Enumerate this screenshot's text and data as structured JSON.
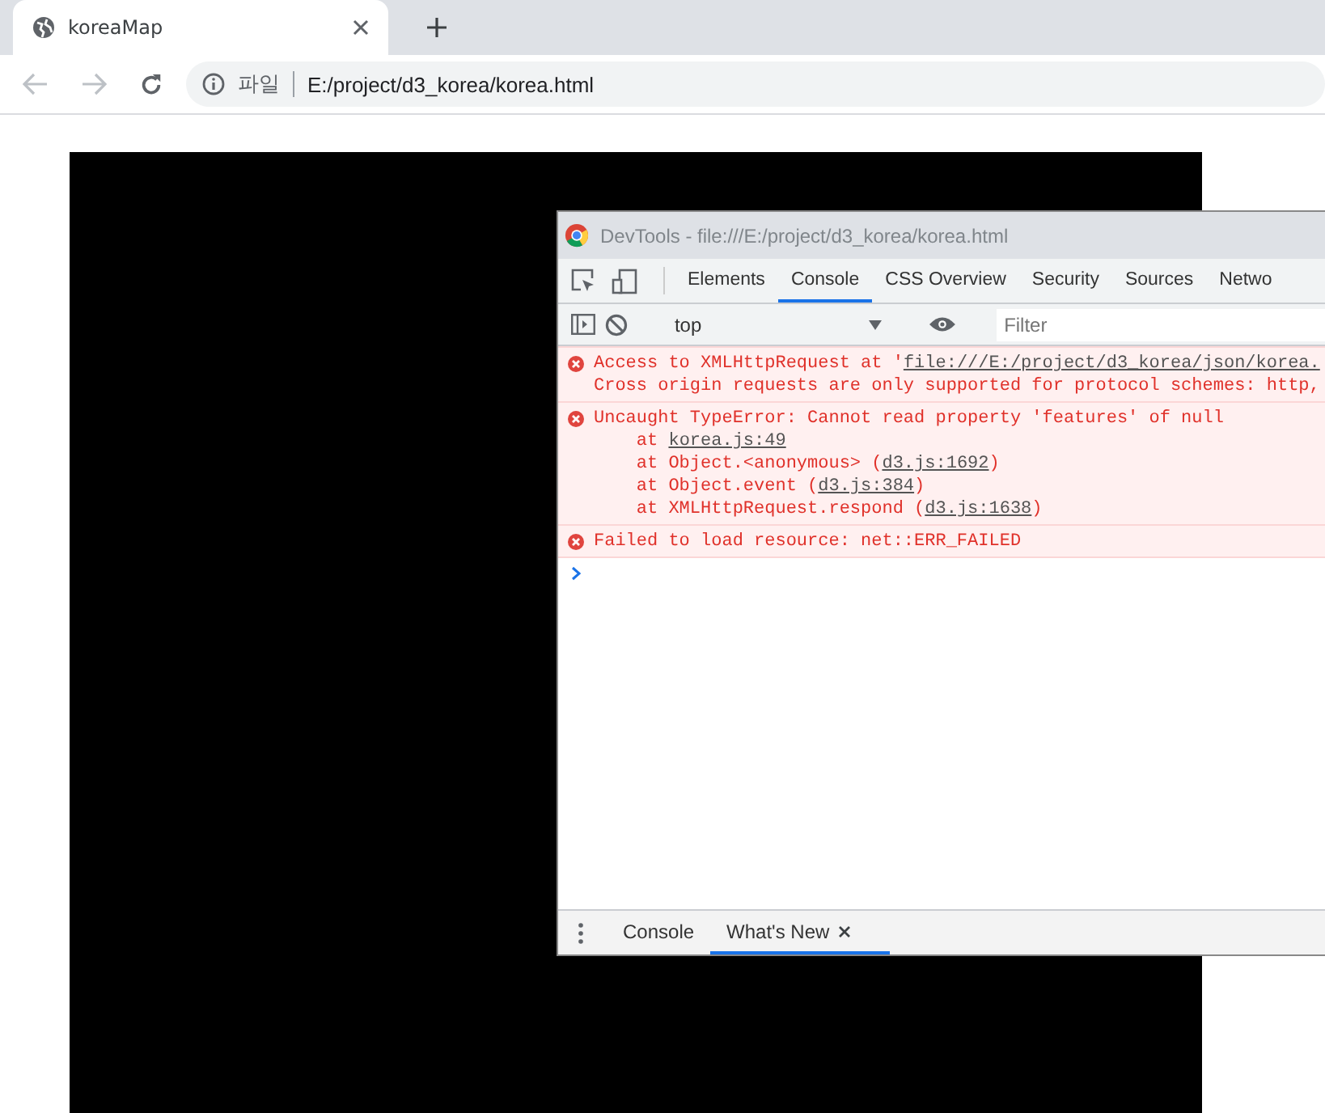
{
  "browser": {
    "tab": {
      "title": "koreaMap"
    },
    "address": {
      "scheme_label": "파일",
      "url": "E:/project/d3_korea/korea.html"
    }
  },
  "devtools": {
    "title": "DevTools - file:///E:/project/d3_korea/korea.html",
    "tabs": [
      {
        "label": "Elements",
        "selected": false
      },
      {
        "label": "Console",
        "selected": true
      },
      {
        "label": "CSS Overview",
        "selected": false
      },
      {
        "label": "Security",
        "selected": false
      },
      {
        "label": "Sources",
        "selected": false
      },
      {
        "label": "Netwo",
        "selected": false
      }
    ],
    "context": "top",
    "filter": {
      "placeholder": "Filter"
    },
    "messages": [
      {
        "lines": [
          {
            "text": "Access to XMLHttpRequest at '",
            "link": "file:///E:/project/d3_korea/json/korea."
          },
          {
            "text": "Cross origin requests are only supported for protocol schemes: http,"
          }
        ]
      },
      {
        "lines": [
          {
            "text": "Uncaught TypeError: Cannot read property 'features' of null"
          },
          {
            "text": "    at ",
            "link": "korea.js:49"
          },
          {
            "text": "    at Object.<anonymous> (",
            "link": "d3.js:1692",
            "after": ")"
          },
          {
            "text": "    at Object.event (",
            "link": "d3.js:384",
            "after": ")"
          },
          {
            "text": "    at XMLHttpRequest.respond (",
            "link": "d3.js:1638",
            "after": ")"
          }
        ]
      },
      {
        "lines": [
          {
            "text": "Failed to load resource: net::ERR_FAILED"
          }
        ]
      }
    ],
    "drawer_tabs": [
      {
        "label": "Console",
        "selected": false,
        "closable": false
      },
      {
        "label": "What's New",
        "selected": true,
        "closable": true
      }
    ]
  }
}
